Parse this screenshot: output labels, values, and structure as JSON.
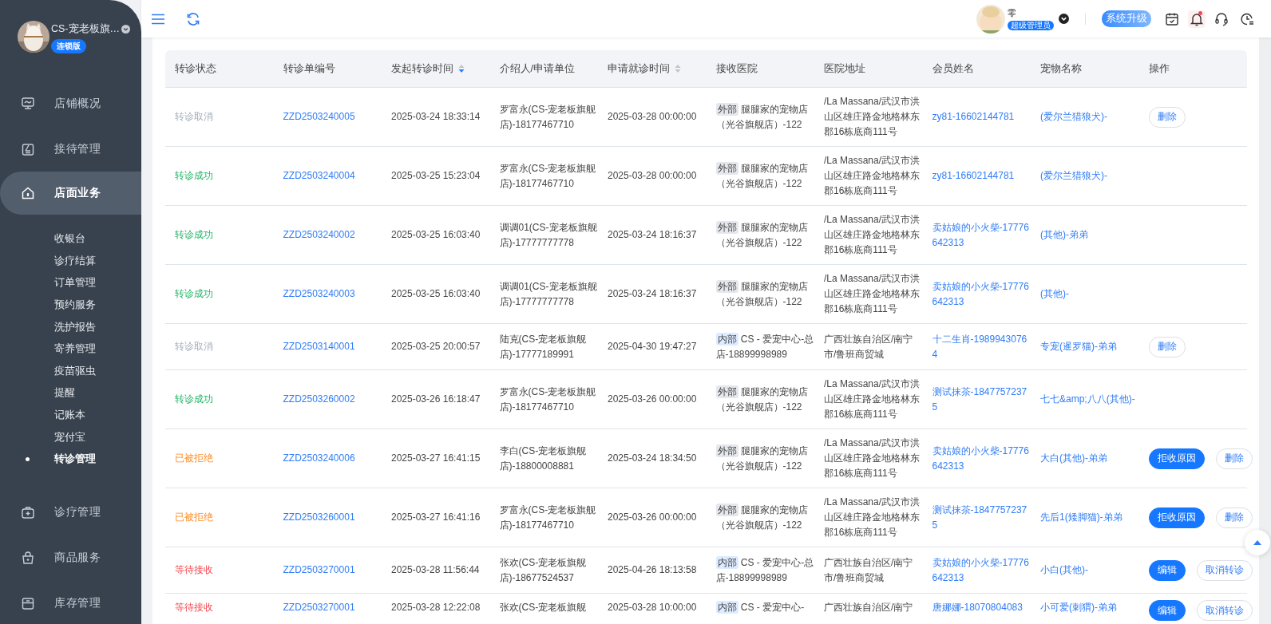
{
  "sidebar": {
    "shop_name": "CS-宠老板旗…",
    "edition_badge": "连锁版",
    "items": [
      {
        "label": "店铺概况",
        "selected": false
      },
      {
        "label": "接待管理",
        "selected": false
      },
      {
        "label": "店面业务",
        "selected": true,
        "children": [
          {
            "label": "收银台",
            "selected": false
          },
          {
            "label": "诊疗结算",
            "selected": false
          },
          {
            "label": "订单管理",
            "selected": false
          },
          {
            "label": "预约服务",
            "selected": false
          },
          {
            "label": "洗护报告",
            "selected": false
          },
          {
            "label": "寄养管理",
            "selected": false
          },
          {
            "label": "疫苗驱虫",
            "selected": false
          },
          {
            "label": "提醒",
            "selected": false
          },
          {
            "label": "记账本",
            "selected": false
          },
          {
            "label": "宠付宝",
            "selected": false
          },
          {
            "label": "转诊管理",
            "selected": true
          }
        ]
      },
      {
        "label": "诊疗管理",
        "selected": false
      },
      {
        "label": "商品服务",
        "selected": false
      },
      {
        "label": "库存管理",
        "selected": false
      }
    ]
  },
  "topbar": {
    "user_name": "零",
    "role_badge": "超级管理员",
    "upgrade_button": "系统升级",
    "notification_dot": true
  },
  "table": {
    "columns": [
      {
        "label": "转诊状态"
      },
      {
        "label": "转诊单编号"
      },
      {
        "label": "发起转诊时间",
        "sortable": true,
        "sorted_descending": true
      },
      {
        "label": "介绍人/申请单位"
      },
      {
        "label": "申请就诊时间",
        "sortable": true,
        "sorted_descending": false
      },
      {
        "label": "接收医院"
      },
      {
        "label": "医院地址"
      },
      {
        "label": "会员姓名"
      },
      {
        "label": "宠物名称"
      },
      {
        "label": "操作"
      }
    ],
    "rows": [
      {
        "status": {
          "text": "转诊取消",
          "kind": "cancelled"
        },
        "order_no": "ZZD2503240005",
        "created_at": "2025-03-24 18:33:14",
        "referrer": "罗富永(CS-宠老板旗舰店)-18177467710",
        "visit_time": "2025-03-28 00:00:00",
        "hospital": {
          "tag": {
            "text": "外部",
            "kind": "external"
          },
          "name": "腿腿家的宠物店（光谷旗舰店）-122"
        },
        "address": "/La Massana/武汉市洪山区雄庄路金地格林东郡16栋底商111号",
        "member": "zy81-16602144781",
        "pet": "(爱尔兰猎狼犬)-",
        "actions": [
          {
            "label": "删除",
            "kind": "outline"
          }
        ]
      },
      {
        "status": {
          "text": "转诊成功",
          "kind": "success"
        },
        "order_no": "ZZD2503240004",
        "created_at": "2025-03-25 15:23:04",
        "referrer": "罗富永(CS-宠老板旗舰店)-18177467710",
        "visit_time": "2025-03-28 00:00:00",
        "hospital": {
          "tag": {
            "text": "外部",
            "kind": "external"
          },
          "name": "腿腿家的宠物店（光谷旗舰店）-122"
        },
        "address": "/La Massana/武汉市洪山区雄庄路金地格林东郡16栋底商111号",
        "member": "zy81-16602144781",
        "pet": "(爱尔兰猎狼犬)-",
        "actions": []
      },
      {
        "status": {
          "text": "转诊成功",
          "kind": "success"
        },
        "order_no": "ZZD2503240002",
        "created_at": "2025-03-25 16:03:40",
        "referrer": "调调01(CS-宠老板旗舰店)-17777777778",
        "visit_time": "2025-03-24 18:16:37",
        "hospital": {
          "tag": {
            "text": "外部",
            "kind": "external"
          },
          "name": "腿腿家的宠物店（光谷旗舰店）-122"
        },
        "address": "/La Massana/武汉市洪山区雄庄路金地格林东郡16栋底商111号",
        "member": "卖姑娘的小火柴-17776642313",
        "pet": "(其他)-弟弟",
        "actions": []
      },
      {
        "status": {
          "text": "转诊成功",
          "kind": "success"
        },
        "order_no": "ZZD2503240003",
        "created_at": "2025-03-25 16:03:40",
        "referrer": "调调01(CS-宠老板旗舰店)-17777777778",
        "visit_time": "2025-03-24 18:16:37",
        "hospital": {
          "tag": {
            "text": "外部",
            "kind": "external"
          },
          "name": "腿腿家的宠物店（光谷旗舰店）-122"
        },
        "address": "/La Massana/武汉市洪山区雄庄路金地格林东郡16栋底商111号",
        "member": "卖姑娘的小火柴-17776642313",
        "pet": "(其他)-",
        "actions": []
      },
      {
        "status": {
          "text": "转诊取消",
          "kind": "cancelled"
        },
        "order_no": "ZZD2503140001",
        "created_at": "2025-03-25 20:00:57",
        "referrer": "陆克(CS-宠老板旗舰店)-17777189991",
        "visit_time": "2025-04-30 19:47:27",
        "hospital": {
          "tag": {
            "text": "内部",
            "kind": "internal"
          },
          "name": "CS - 爱宠中心-总店-18899998989"
        },
        "address": "广西壮族自治区/南宁市/鲁班商贸城",
        "member": "十二生肖-19899430764",
        "pet": "专宠(暹罗猫)-弟弟",
        "actions": [
          {
            "label": "删除",
            "kind": "outline"
          }
        ]
      },
      {
        "status": {
          "text": "转诊成功",
          "kind": "success"
        },
        "order_no": "ZZD2503260002",
        "created_at": "2025-03-26 16:18:47",
        "referrer": "罗富永(CS-宠老板旗舰店)-18177467710",
        "visit_time": "2025-03-26 00:00:00",
        "hospital": {
          "tag": {
            "text": "外部",
            "kind": "external"
          },
          "name": "腿腿家的宠物店（光谷旗舰店）-122"
        },
        "address": "/La Massana/武汉市洪山区雄庄路金地格林东郡16栋底商111号",
        "member": "测试抹茶-18477572375",
        "pet": "七七&amp;八八(其他)-",
        "actions": []
      },
      {
        "status": {
          "text": "已被拒绝",
          "kind": "rejected"
        },
        "order_no": "ZZD2503240006",
        "created_at": "2025-03-27 16:41:15",
        "referrer": "李白(CS-宠老板旗舰店)-18800008881",
        "visit_time": "2025-03-24 18:34:50",
        "hospital": {
          "tag": {
            "text": "外部",
            "kind": "external"
          },
          "name": "腿腿家的宠物店（光谷旗舰店）-122"
        },
        "address": "/La Massana/武汉市洪山区雄庄路金地格林东郡16栋底商111号",
        "member": "卖姑娘的小火柴-17776642313",
        "pet": "大白(其他)-弟弟",
        "actions": [
          {
            "label": "拒收原因",
            "kind": "primary"
          },
          {
            "label": "删除",
            "kind": "outline"
          }
        ]
      },
      {
        "status": {
          "text": "已被拒绝",
          "kind": "rejected"
        },
        "order_no": "ZZD2503260001",
        "created_at": "2025-03-27 16:41:16",
        "referrer": "罗富永(CS-宠老板旗舰店)-18177467710",
        "visit_time": "2025-03-26 00:00:00",
        "hospital": {
          "tag": {
            "text": "外部",
            "kind": "external"
          },
          "name": "腿腿家的宠物店（光谷旗舰店）-122"
        },
        "address": "/La Massana/武汉市洪山区雄庄路金地格林东郡16栋底商111号",
        "member": "测试抹茶-18477572375",
        "pet": "先后1(矮脚猫)-弟弟",
        "actions": [
          {
            "label": "拒收原因",
            "kind": "primary"
          },
          {
            "label": "删除",
            "kind": "outline"
          }
        ]
      },
      {
        "status": {
          "text": "等待接收",
          "kind": "pending"
        },
        "order_no": "ZZD2503270001",
        "created_at": "2025-03-28 11:56:44",
        "referrer": "张欢(CS-宠老板旗舰店)-18677524537",
        "visit_time": "2025-04-26 18:13:58",
        "hospital": {
          "tag": {
            "text": "内部",
            "kind": "internal"
          },
          "name": "CS - 爱宠中心-总店-18899998989"
        },
        "address": "广西壮族自治区/南宁市/鲁班商贸城",
        "member": "卖姑娘的小火柴-17776642313",
        "pet": "小白(其他)-",
        "actions": [
          {
            "label": "编辑",
            "kind": "primary"
          },
          {
            "label": "取消转诊",
            "kind": "outline"
          }
        ]
      },
      {
        "status": {
          "text": "等待接收",
          "kind": "pending"
        },
        "order_no": "ZZD2503270001",
        "created_at": "2025-03-28 12:22:08",
        "referrer": "张欢(CS-宠老板旗舰",
        "visit_time": "2025-03-28 10:00:00",
        "hospital": {
          "tag": {
            "text": "内部",
            "kind": "internal"
          },
          "name": "CS - 爱宠中心-"
        },
        "address": "广西壮族自治区/南宁",
        "member": "唐娜娜-18070804083",
        "pet": "小可爱(刺猬)-弟弟",
        "actions": [
          {
            "label": "编辑",
            "kind": "primary"
          },
          {
            "label": "取消转诊",
            "kind": "outline"
          }
        ]
      }
    ]
  }
}
